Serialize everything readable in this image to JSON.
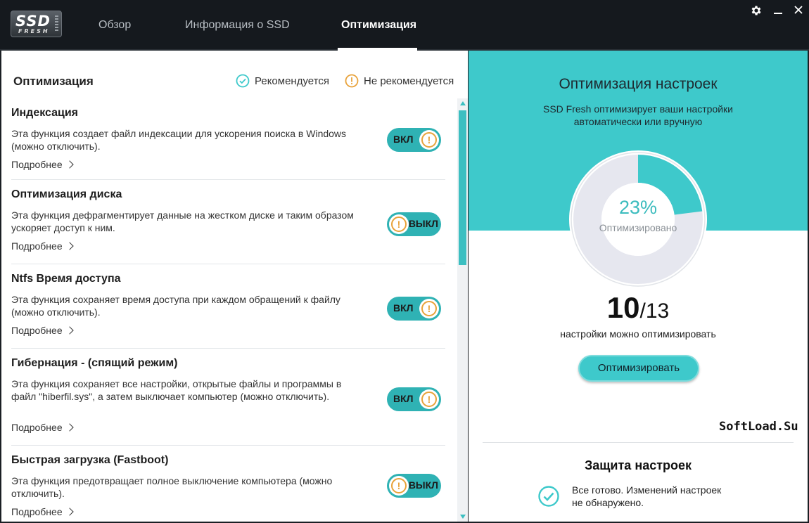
{
  "app": {
    "logo_main": "SSD",
    "logo_sub": "FRESH"
  },
  "tabs": [
    {
      "label": "Обзор"
    },
    {
      "label": "Информация о SSD"
    },
    {
      "label": "Оптимизация"
    }
  ],
  "active_tab": "Оптимизация",
  "window_controls": {
    "settings": "gear-icon",
    "minimize": "–",
    "close": "✕"
  },
  "left": {
    "title": "Оптимизация",
    "legend": {
      "recommended": "Рекомендуется",
      "not_recommended": "Не рекомендуется"
    },
    "items": [
      {
        "title": "Индексация",
        "desc": "Эта функция создает файл индексации для ускорения поиска в Windows (можно отключить).",
        "more": "Подробнее",
        "state": "ВКЛ"
      },
      {
        "title": "Оптимизация диска",
        "desc": "Эта функция дефрагментирует данные на жестком диске и таким образом ускоряет доступ к ним.",
        "more": "Подробнее",
        "state": "ВЫКЛ"
      },
      {
        "title": "Ntfs Время доступа",
        "desc": "Эта функция сохраняет время доступа при каждом обращений к файлу (можно отключить).",
        "more": "Подробнее",
        "state": "ВКЛ"
      },
      {
        "title": "Гибернация - (спящий режим)",
        "desc": "Эта функция сохраняет все настройки, открытые файлы и программы в файл \"hiberfil.sys\", а затем выключает компьютер (можно отключить).",
        "more": "Подробнее",
        "state": "ВКЛ"
      },
      {
        "title": "Быстрая загрузка (Fastboot)",
        "desc": "Эта функция предотвращает полное выключение компьютера (можно отключить).",
        "more": "Подробнее",
        "state": "ВЫКЛ"
      }
    ]
  },
  "right": {
    "title": "Оптимизация настроек",
    "subtitle": "SSD Fresh оптимизирует ваши настройки автоматически или вручную",
    "gauge": {
      "percent": 23,
      "percent_text": "23%",
      "label": "Оптимизировано"
    },
    "count": {
      "value": "10",
      "slash": "/",
      "total": "13",
      "label": "настройки можно оптимизировать"
    },
    "button": "Оптимизировать",
    "watermark": "SoftLoad.Su",
    "protection": {
      "title": "Защита настроек",
      "text": "Все готово. Изменений настроек не обнаружено."
    }
  },
  "colors": {
    "accent": "#3ec9cb",
    "toggle": "#2fb2b4",
    "warning": "#e8a23a",
    "titlebar": "#15191e"
  }
}
